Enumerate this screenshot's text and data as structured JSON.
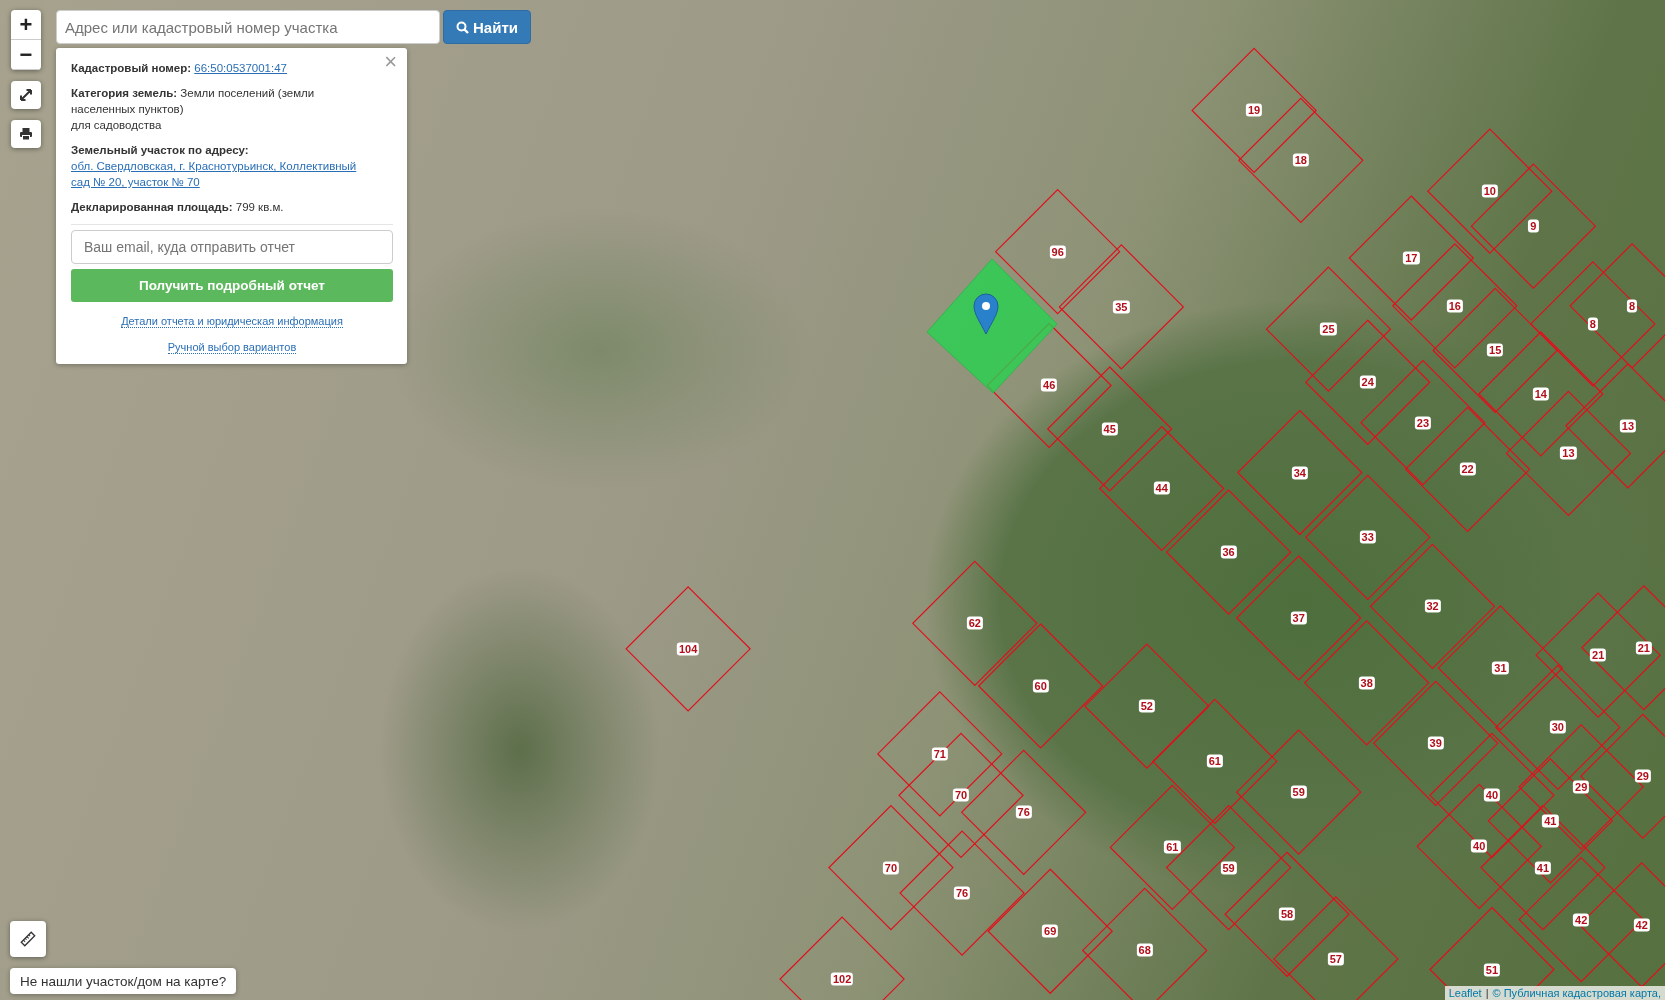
{
  "search": {
    "placeholder": "Адрес или кадастровый номер участка",
    "button": "Найти"
  },
  "zoom_controls": {
    "zoom_in": "+",
    "zoom_out": "−"
  },
  "popup": {
    "close": "×",
    "rows": [
      {
        "label": "Кадастровый номер:",
        "value": "66:50:0537001:47",
        "kind": "link"
      },
      {
        "label": "Категория земель:",
        "value": "Земли поселений (земли населенных пунктов)",
        "extra": "для садоводства",
        "kind": "text"
      },
      {
        "label": "Земельный участок по адресу:",
        "value": "обл. Свердловская, г. Краснотурьинск, Коллективный сад № 20, участок № 70",
        "kind": "link"
      },
      {
        "label": "Декларированная площадь:",
        "value": "799 кв.м.",
        "kind": "text"
      }
    ],
    "email_placeholder": "Ваш email, куда отправить отчет",
    "submit": "Получить подробный отчет",
    "links": [
      "Детали отчета и юридическая информация",
      "Ручной выбор вариантов"
    ]
  },
  "not_found_button": "Не нашли участок/дом на карте?",
  "attribution": {
    "leaflet": "Leaflet",
    "separator": "|",
    "source": "© Публичная кадастровая карта,"
  },
  "parcels": [
    "19",
    "18",
    "10",
    "9",
    "96",
    "17",
    "35",
    "16",
    "8",
    "25",
    "8",
    "15",
    "46",
    "24",
    "14",
    "45",
    "23",
    "13",
    "13",
    "34",
    "22",
    "44",
    "33",
    "36",
    "62",
    "37",
    "32",
    "104",
    "31",
    "21",
    "21",
    "60",
    "38",
    "52",
    "30",
    "71",
    "39",
    "61",
    "70",
    "59",
    "40",
    "29",
    "29",
    "76",
    "41",
    "61",
    "40",
    "70",
    "59",
    "41",
    "76",
    "58",
    "69",
    "42",
    "42",
    "68",
    "57",
    "102",
    "51"
  ]
}
